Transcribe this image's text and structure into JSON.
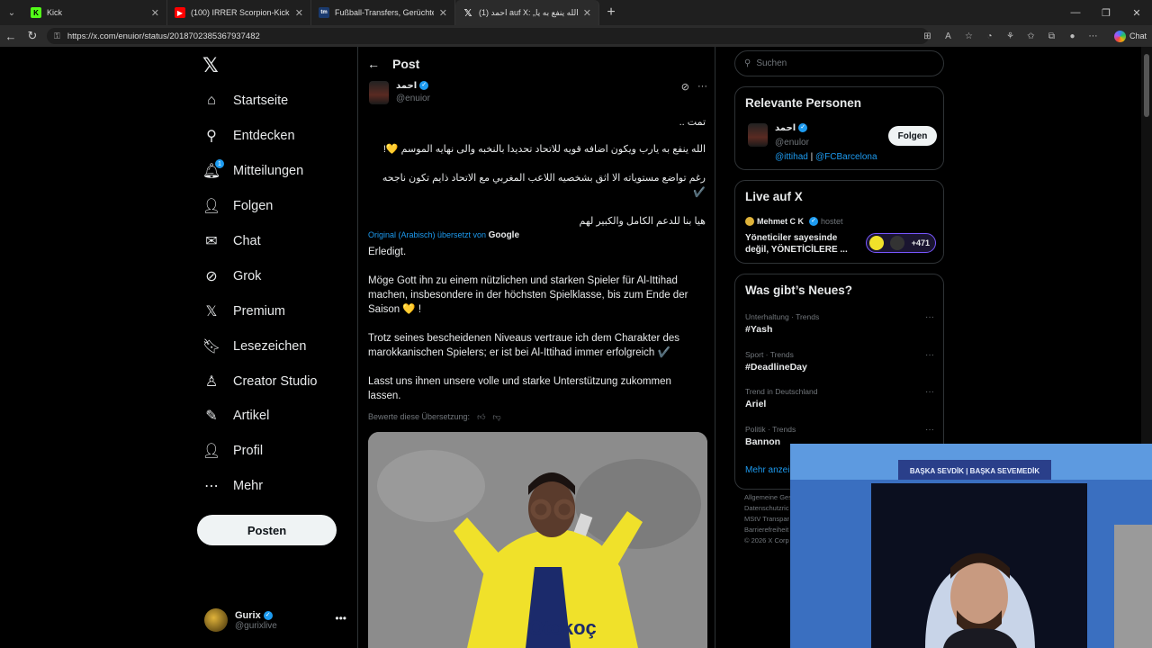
{
  "browser": {
    "tabs": [
      {
        "title": "Kick",
        "icon_color": "#53fc18",
        "icon_glyph": "K"
      },
      {
        "title": "(100) IRRER Scorpion-Kick zum Ca",
        "icon_color": "#ff0000",
        "icon_glyph": "▶"
      },
      {
        "title": "Fußball-Transfers, Gerüchte, Markt",
        "icon_color": "#1a3a6e",
        "icon_glyph": "tm"
      },
      {
        "title": "(1) احمد auf X: „تمت .. الله ينفع به يا",
        "icon_color": "#000000",
        "icon_glyph": "𝕏"
      }
    ],
    "url": "https://x.com/enuior/status/2018702385367937482",
    "chat_label": "Chat"
  },
  "sidebar": {
    "items": [
      {
        "label": "Startseite",
        "icon": "home-icon",
        "glyph": "⌂"
      },
      {
        "label": "Entdecken",
        "icon": "search-icon",
        "glyph": "⚲"
      },
      {
        "label": "Mitteilungen",
        "icon": "bell-icon",
        "glyph": "🔔︎",
        "badge": "1"
      },
      {
        "label": "Folgen",
        "icon": "person-add-icon",
        "glyph": "👤︎"
      },
      {
        "label": "Chat",
        "icon": "mail-icon",
        "glyph": "✉"
      },
      {
        "label": "Grok",
        "icon": "grok-icon",
        "glyph": "⊘"
      },
      {
        "label": "Premium",
        "icon": "x-icon",
        "glyph": "𝕏"
      },
      {
        "label": "Lesezeichen",
        "icon": "bookmark-icon",
        "glyph": "🔖︎"
      },
      {
        "label": "Creator Studio",
        "icon": "creator-icon",
        "glyph": "♙"
      },
      {
        "label": "Artikel",
        "icon": "article-icon",
        "glyph": "✎"
      },
      {
        "label": "Profil",
        "icon": "person-icon",
        "glyph": "👤︎"
      },
      {
        "label": "Mehr",
        "icon": "more-circle-icon",
        "glyph": "⋯"
      }
    ],
    "post_button": "Posten",
    "account": {
      "name": "Gurix",
      "handle": "@gurixlive"
    }
  },
  "main": {
    "header": "Post",
    "author": {
      "name": "احمد",
      "handle": "@enuior"
    },
    "arabic_lines": [
      "تمت ..",
      "الله ينفع به يارب ويكون اضافه قويه للاتحاد تحديدا بالنخبه والى نهايه الموسم 💛!",
      "رغم تواضع مستوياته الا اثق بشخصيه اللاعب المغربي مع الاتحاد ذايم تكون ناجحه",
      "✔️",
      "هيا بنا للدعم الكامل والكبير لهم"
    ],
    "translation_note": "Original (Arabisch) übersetzt von",
    "translation_brand": "Google",
    "german": [
      "Erledigt.",
      "Möge Gott ihn zu einem nützlichen und starken Spieler für Al-Ittihad machen, insbesondere in der höchsten Spielklasse, bis zum Ende der Saison 💛 !",
      "Trotz seines bescheidenen Niveaus vertraue ich dem Charakter des marokkanischen Spielers; er ist bei Al-Ittihad immer erfolgreich ✔️",
      "Lasst uns ihnen unsere volle und starke Unterstützung zukommen lassen."
    ],
    "rate_label": "Bewerte diese Übersetzung:"
  },
  "right": {
    "search_placeholder": "Suchen",
    "relevant": {
      "title": "Relevante Personen",
      "name": "احمد",
      "handle": "@enulor",
      "follow": "Folgen",
      "bio_link1": "@ittihad",
      "bio_sep": "|",
      "bio_link2": "@FCBarcelona"
    },
    "live": {
      "title": "Live auf X",
      "host": "Mehmet C K",
      "host_suffix": "hostet",
      "text": "Yöneticiler sayesinde değil, YÖNETİCİLERE ...",
      "count": "+471"
    },
    "news": {
      "title": "Was gibt’s Neues?",
      "trends": [
        {
          "category": "Unterhaltung · Trends",
          "topic": "#Yash"
        },
        {
          "category": "Sport · Trends",
          "topic": "#DeadlineDay"
        },
        {
          "category": "Trend in Deutschland",
          "topic": "Ariel"
        },
        {
          "category": "Politik · Trends",
          "topic": "Bannon"
        }
      ],
      "more": "Mehr anzei"
    },
    "footer": [
      "Allgemeine Ges",
      "Datenschutzric",
      "MStV Transpar",
      "Barrierefreiheit",
      "© 2026 X Corp"
    ]
  },
  "webcam": {
    "banner": "BAŞKA SEVDİK | BAŞKA SEVEMEDİK"
  },
  "photo": {
    "jersey": "Otokoç"
  }
}
